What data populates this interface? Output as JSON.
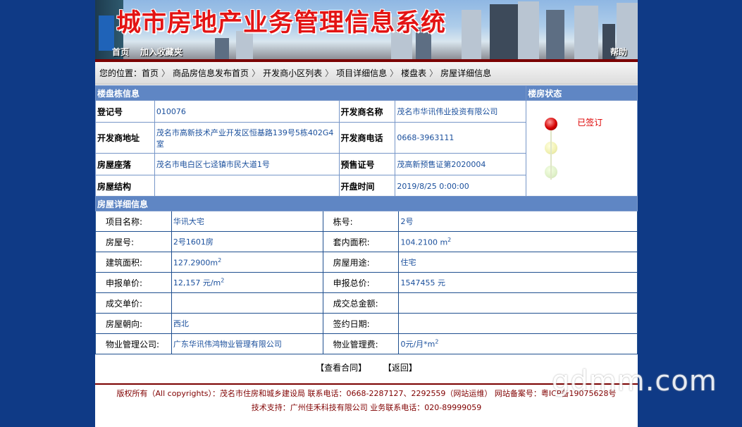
{
  "header": {
    "title": "城市房地产业务管理信息系统",
    "nav_home": "首页",
    "nav_favorite": "加入收藏夹",
    "nav_help": "帮助"
  },
  "breadcrumb": {
    "prefix": "您的位置：",
    "items": [
      "首页",
      "商品房信息发布首页",
      "开发商小区列表",
      "项目详细信息",
      "楼盘表",
      "房屋详细信息"
    ]
  },
  "building": {
    "section_title": "楼盘栋信息",
    "status_title": "楼房状态",
    "status_value": "已签订",
    "rows": [
      {
        "k1": "登记号",
        "v1": "010076",
        "k2": "开发商名称",
        "v2": "茂名市华讯伟业投资有限公司"
      },
      {
        "k1": "开发商地址",
        "v1": "茂名市高新技术产业开发区恒基路139号5栋402G4室",
        "k2": "开发商电话",
        "v2": "0668-3963111"
      },
      {
        "k1": "房屋座落",
        "v1": "茂名市电白区七迳镇市民大道1号",
        "k2": "预售证号",
        "v2": "茂高新预售证第2020004"
      },
      {
        "k1": "房屋结构",
        "v1": "",
        "k2": "开盘时间",
        "v2": "2019/8/25 0:00:00"
      }
    ]
  },
  "house": {
    "section_title": "房屋详细信息",
    "rows": [
      {
        "k1": "项目名称:",
        "v1": "华讯大宅",
        "k2": "栋号:",
        "v2": "2号"
      },
      {
        "k1": "房屋号:",
        "v1": "2号1601房",
        "k2": "套内面积:",
        "v2": "104.2100 m",
        "v2_sup": "2"
      },
      {
        "k1": "建筑面积:",
        "v1": "127.2900m",
        "v1_sup": "2",
        "k2": "房屋用途:",
        "v2": "住宅"
      },
      {
        "k1": "申报单价:",
        "v1": "12,157 元/m",
        "v1_sup": "2",
        "k2": "申报总价:",
        "v2": "1547455 元"
      },
      {
        "k1": "成交单价:",
        "v1": "",
        "k2": "成交总金额:",
        "v2": ""
      },
      {
        "k1": "房屋朝向:",
        "v1": "西北",
        "k2": "签约日期:",
        "v2": ""
      },
      {
        "k1": "物业管理公司:",
        "v1": "广东华讯伟鸿物业管理有限公司",
        "k2": "物业管理费:",
        "v2": "0元/月*m",
        "v2_sup": "2"
      }
    ]
  },
  "actions": {
    "view_contract": "【查看合同】",
    "back": "【返回】"
  },
  "footer": {
    "line1": "版权所有（All copyrights）：茂名市住房和城乡建设局 联系电话：0668-2287127、2292559（网站运维） 网站备案号：粤ICP备19075628号",
    "line2": "技术支持：广州佳禾科技有限公司    业务联系电话：020-89999059"
  },
  "watermark": "gdmm.com",
  "colors": {
    "page_bg": "#0f3a86",
    "section_header": "#5f86c4",
    "title_red": "#e31414",
    "status_red": "#dd0000"
  }
}
